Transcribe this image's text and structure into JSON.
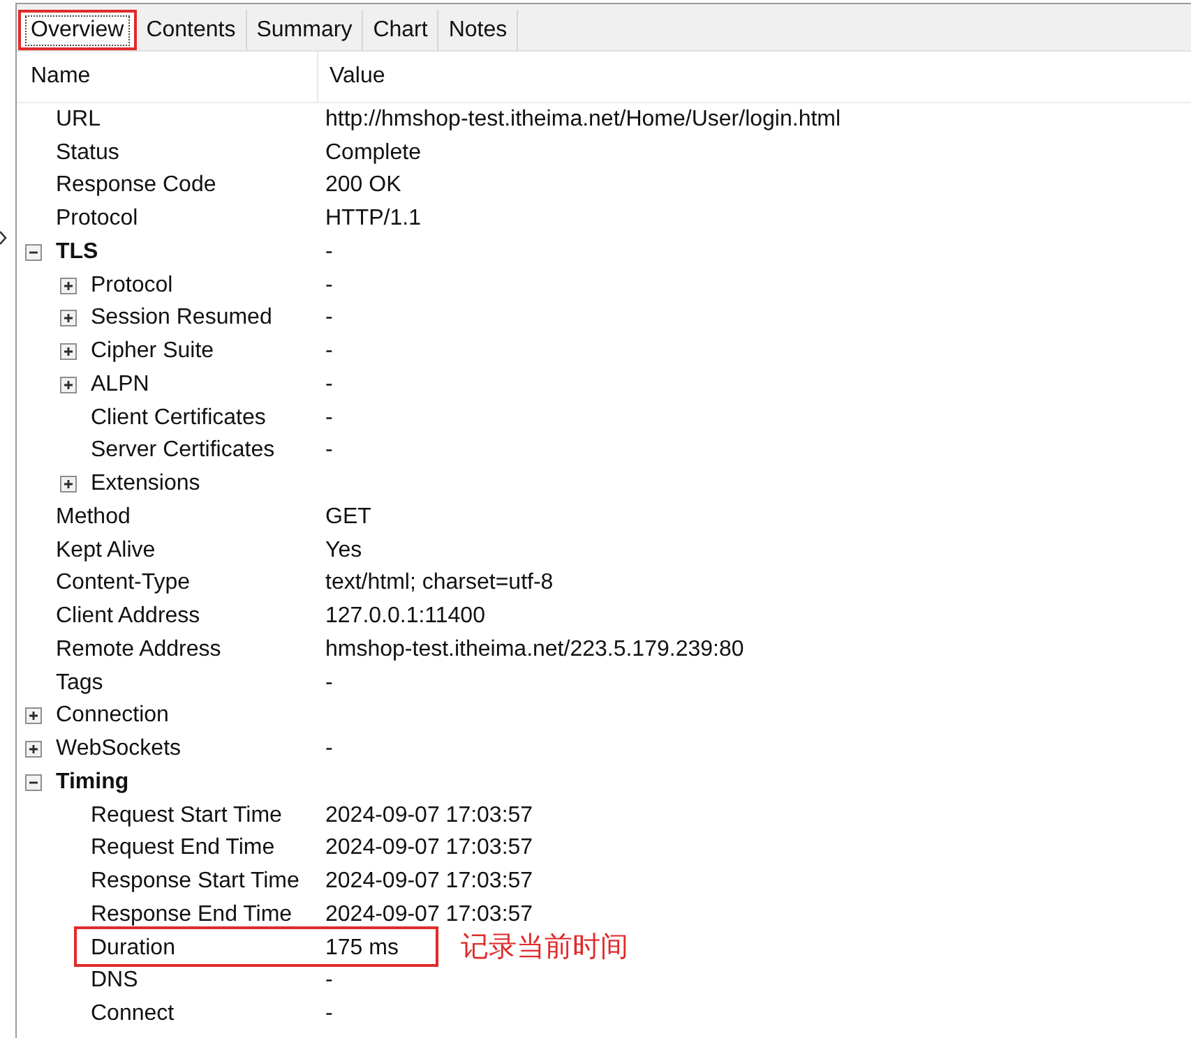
{
  "tabs": [
    {
      "label": "Overview",
      "selected": true,
      "highlighted": true
    },
    {
      "label": "Contents",
      "selected": false,
      "highlighted": false
    },
    {
      "label": "Summary",
      "selected": false,
      "highlighted": false
    },
    {
      "label": "Chart",
      "selected": false,
      "highlighted": false
    },
    {
      "label": "Notes",
      "selected": false,
      "highlighted": false
    }
  ],
  "tree": {
    "columns": [
      "Name",
      "Value"
    ],
    "rows": [
      {
        "kind": "field",
        "name": "URL",
        "value": "http://hmshop-test.itheima.net/Home/User/login.html",
        "highlighted": false
      },
      {
        "kind": "field",
        "name": "Status",
        "value": "Complete",
        "highlighted": false
      },
      {
        "kind": "field",
        "name": "Response Code",
        "value": "200 OK",
        "highlighted": false
      },
      {
        "kind": "field",
        "name": "Protocol",
        "value": "HTTP/1.1",
        "highlighted": false
      },
      {
        "kind": "group",
        "name": "TLS",
        "value": "-",
        "expanded": true,
        "highlighted": false,
        "children": [
          {
            "kind": "group",
            "name": "Protocol",
            "value": "-",
            "expanded": false,
            "highlighted": false
          },
          {
            "kind": "group",
            "name": "Session Resumed",
            "value": "-",
            "expanded": false,
            "highlighted": false
          },
          {
            "kind": "group",
            "name": "Cipher Suite",
            "value": "-",
            "expanded": false,
            "highlighted": false
          },
          {
            "kind": "group",
            "name": "ALPN",
            "value": "-",
            "expanded": false,
            "highlighted": false
          },
          {
            "kind": "field",
            "name": "Client Certificates",
            "value": "-",
            "highlighted": false
          },
          {
            "kind": "field",
            "name": "Server Certificates",
            "value": "-",
            "highlighted": false
          },
          {
            "kind": "group",
            "name": "Extensions",
            "expanded": false,
            "highlighted": false
          }
        ]
      },
      {
        "kind": "field",
        "name": "Method",
        "value": "GET",
        "highlighted": false
      },
      {
        "kind": "field",
        "name": "Kept Alive",
        "value": "Yes",
        "highlighted": false
      },
      {
        "kind": "field",
        "name": "Content-Type",
        "value": "text/html; charset=utf-8",
        "highlighted": false
      },
      {
        "kind": "field",
        "name": "Client Address",
        "value": "127.0.0.1:11400",
        "highlighted": false
      },
      {
        "kind": "field",
        "name": "Remote Address",
        "value": "hmshop-test.itheima.net/223.5.179.239:80",
        "highlighted": false
      },
      {
        "kind": "field",
        "name": "Tags",
        "value": "-",
        "highlighted": false
      },
      {
        "kind": "group",
        "name": "Connection",
        "expanded": false,
        "highlighted": false
      },
      {
        "kind": "group",
        "name": "WebSockets",
        "value": "-",
        "expanded": false,
        "highlighted": false
      },
      {
        "kind": "group",
        "name": "Timing",
        "expanded": true,
        "highlighted": false,
        "children": [
          {
            "kind": "field",
            "name": "Request Start Time",
            "value": "2024-09-07 17:03:57",
            "highlighted": false
          },
          {
            "kind": "field",
            "name": "Request End Time",
            "value": "2024-09-07 17:03:57",
            "highlighted": false
          },
          {
            "kind": "field",
            "name": "Response Start Time",
            "value": "2024-09-07 17:03:57",
            "highlighted": false
          },
          {
            "kind": "field",
            "name": "Response End Time",
            "value": "2024-09-07 17:03:57",
            "highlighted": false
          },
          {
            "kind": "field",
            "name": "Duration",
            "value": "175 ms",
            "highlighted": true,
            "note": "记录当前时间"
          },
          {
            "kind": "field",
            "name": "DNS",
            "value": "-",
            "highlighted": false
          },
          {
            "kind": "field",
            "name": "Connect",
            "value": "-",
            "highlighted": false
          }
        ]
      }
    ]
  }
}
